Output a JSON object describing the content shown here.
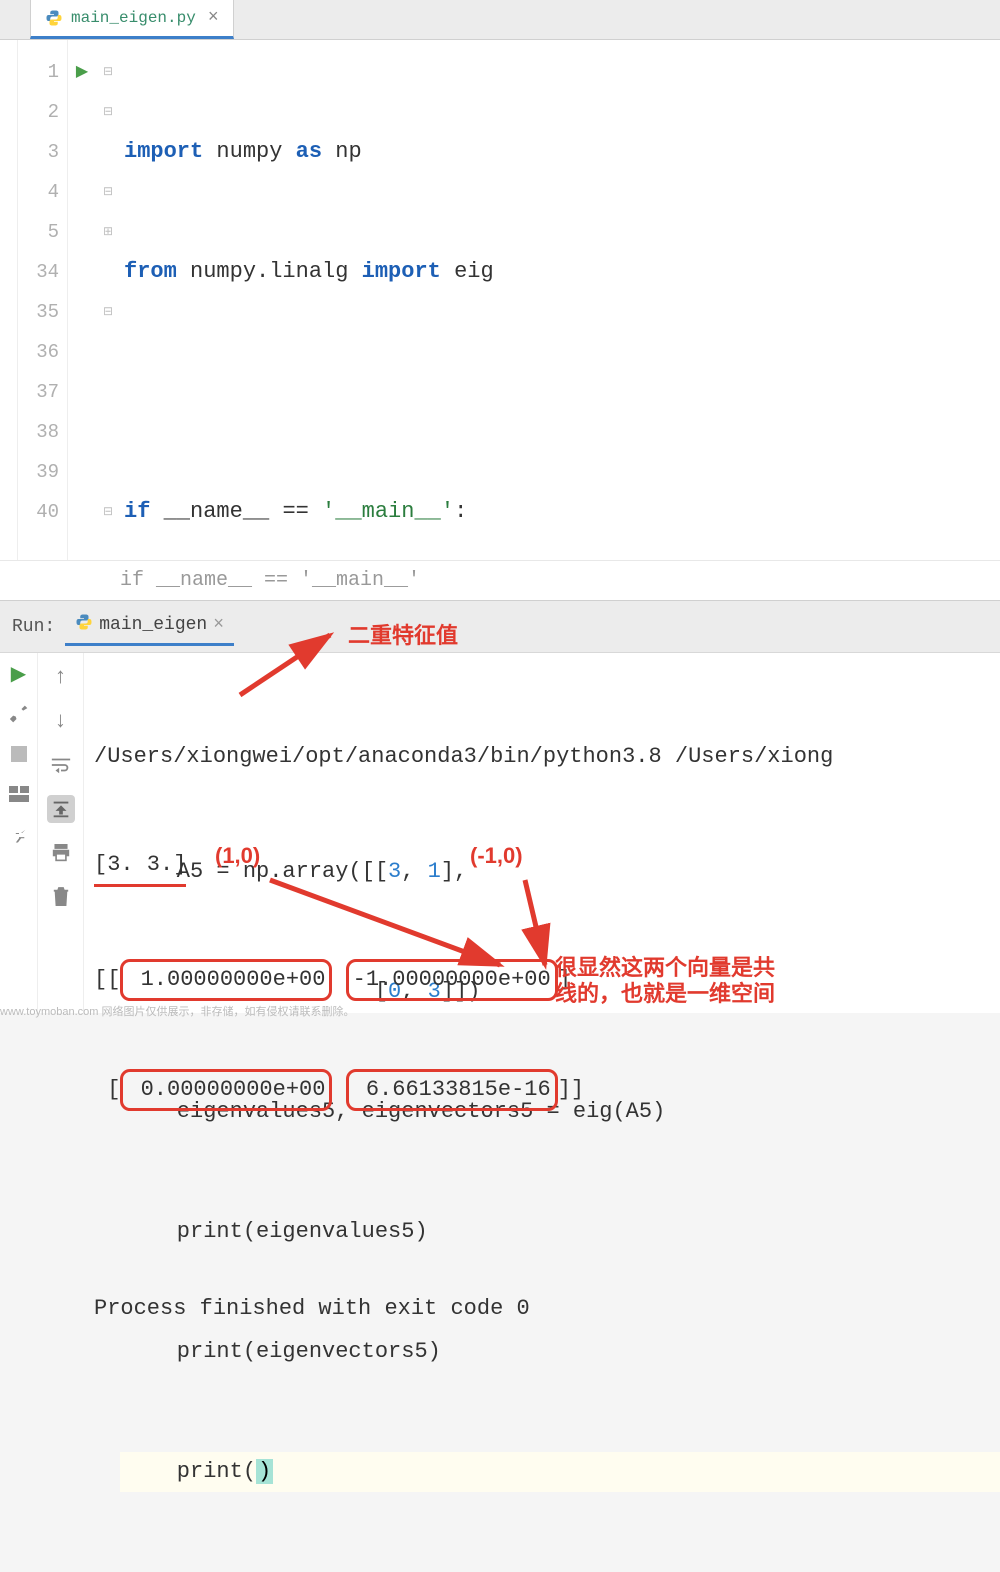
{
  "tab": {
    "filename": "main_eigen.py",
    "close": "×"
  },
  "gutter": [
    "1",
    "2",
    "3",
    "4",
    "5",
    "34",
    "35",
    "36",
    "37",
    "38",
    "39",
    "40"
  ],
  "code": {
    "l1": {
      "kw1": "import",
      "mod": "numpy",
      "kw2": "as",
      "alias": "np"
    },
    "l2": {
      "kw1": "from",
      "mod": "numpy.linalg",
      "kw2": "import",
      "name": "eig"
    },
    "l4": {
      "kw": "if",
      "name": "__name__",
      "eq": "==",
      "str": "'__main__'",
      "colon": ":"
    },
    "l5_ellipsis": "...",
    "l35_a": "    A5 = np.array([[",
    "l35_n1": "3",
    "l35_c": ", ",
    "l35_n2": "1",
    "l35_b": "],",
    "l36_a": "                   [",
    "l36_n1": "0",
    "l36_c": ", ",
    "l36_n2": "3",
    "l36_b": "]])",
    "l37": "    eigenvalues5, eigenvectors5 = eig(A5)",
    "l38": "    print(eigenvalues5)",
    "l39": "    print(eigenvectors5)",
    "l40a": "    print(",
    "l40b": ")"
  },
  "breadcrumb": "if __name__ == '__main__'",
  "run": {
    "label": "Run:",
    "tab": "main_eigen",
    "close": "×"
  },
  "console": {
    "path": "/Users/xiongwei/opt/anaconda3/bin/python3.8 /Users/xiong",
    "eigvals": "[3. 3.]",
    "row1_open": "[[",
    "row1_v1": " 1.00000000e+00",
    "row1_v2": "-1.00000000e+00",
    "row1_close": "]",
    "row2_open": " [",
    "row2_v1": " 0.00000000e+00",
    "row2_v2": " 6.66133815e-16",
    "row2_close": "]]",
    "exit": "Process finished with exit code 0"
  },
  "annotations": {
    "title": "二重特征值",
    "vec1": "(1,0)",
    "vec2": "(-1,0)",
    "note_l1": "很显然这两个向量是共",
    "note_l2": "线的，也就是一维空间"
  },
  "footer": "www.toymoban.com  网络图片仅供展示，非存储，如有侵权请联系删除。"
}
